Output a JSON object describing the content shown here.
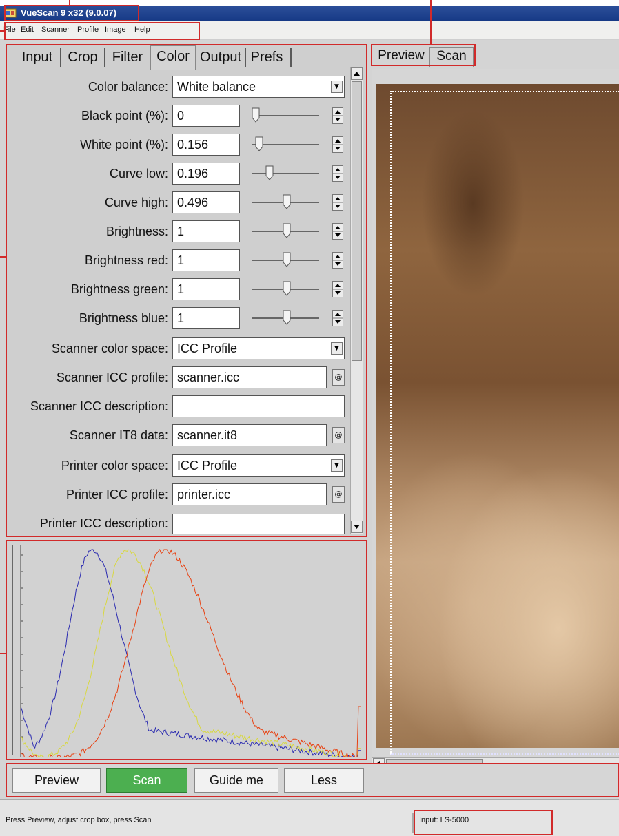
{
  "window": {
    "title": "VueScan 9 x32 (9.0.07)"
  },
  "menu": [
    "File",
    "Edit",
    "Scanner",
    "Profile",
    "Image",
    "Help"
  ],
  "settings_tabs": [
    "Input",
    "Crop",
    "Filter",
    "Color",
    "Output",
    "Prefs"
  ],
  "active_settings_tab": "Color",
  "color_settings": {
    "color_balance": {
      "label": "Color balance:",
      "value": "White balance"
    },
    "black_point": {
      "label": "Black point (%):",
      "value": "0"
    },
    "white_point": {
      "label": "White point (%):",
      "value": "0.156"
    },
    "curve_low": {
      "label": "Curve low:",
      "value": "0.196"
    },
    "curve_high": {
      "label": "Curve high:",
      "value": "0.496"
    },
    "brightness": {
      "label": "Brightness:",
      "value": "1"
    },
    "brightness_red": {
      "label": "Brightness red:",
      "value": "1"
    },
    "brightness_green": {
      "label": "Brightness green:",
      "value": "1"
    },
    "brightness_blue": {
      "label": "Brightness blue:",
      "value": "1"
    },
    "scanner_color_space": {
      "label": "Scanner color space:",
      "value": "ICC Profile"
    },
    "scanner_icc_profile": {
      "label": "Scanner ICC profile:",
      "value": "scanner.icc"
    },
    "scanner_icc_description": {
      "label": "Scanner ICC description:",
      "value": ""
    },
    "scanner_it8_data": {
      "label": "Scanner IT8 data:",
      "value": "scanner.it8"
    },
    "printer_color_space": {
      "label": "Printer color space:",
      "value": "ICC Profile"
    },
    "printer_icc_profile": {
      "label": "Printer ICC profile:",
      "value": "printer.icc"
    },
    "printer_icc_description": {
      "label": "Printer ICC description:",
      "value": ""
    }
  },
  "browse_button_glyph": "@",
  "preview_tabs": [
    "Preview",
    "Scan"
  ],
  "active_preview_tab": "Preview",
  "buttons": {
    "preview": "Preview",
    "scan": "Scan",
    "guide_me": "Guide me",
    "less": "Less"
  },
  "status": {
    "message": "Press Preview, adjust crop box, press Scan",
    "input": "Input: LS-5000"
  },
  "colors": {
    "callout": "#d12a2a",
    "scan_button": "#4caf50",
    "histogram_blue": "#2a2ab0",
    "histogram_yellow": "#d8d840",
    "histogram_red": "#e84010",
    "title_bar": "#1f4590"
  },
  "icons": [
    "vuescan-app-icon",
    "dropdown-arrow-icon",
    "spinner-icon",
    "browse-icon",
    "scroll-up-arrow-icon",
    "scroll-down-arrow-icon",
    "scroll-left-arrow-icon"
  ]
}
